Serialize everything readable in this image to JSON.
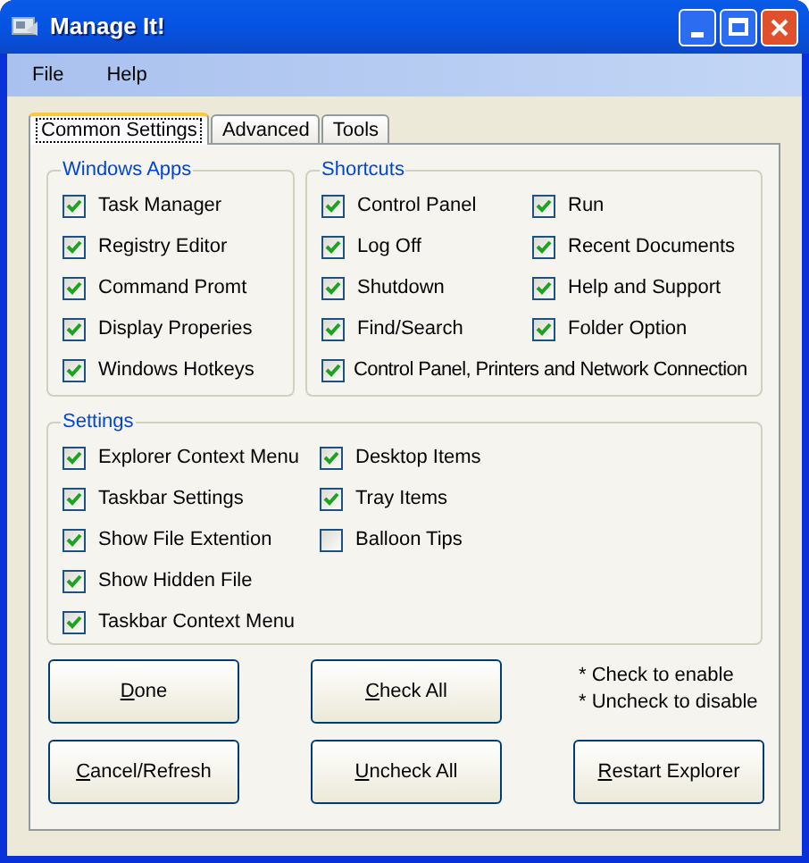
{
  "window": {
    "title": "Manage It!"
  },
  "menu": [
    "File",
    "Help"
  ],
  "tabs": [
    {
      "label": "Common Settings",
      "selected": true
    },
    {
      "label": "Advanced",
      "selected": false
    },
    {
      "label": "Tools",
      "selected": false
    }
  ],
  "windows_apps": {
    "title": "Windows Apps",
    "items": [
      {
        "label": "Task Manager",
        "checked": true
      },
      {
        "label": "Registry Editor",
        "checked": true
      },
      {
        "label": "Command Promt",
        "checked": true
      },
      {
        "label": "Display Properies",
        "checked": true
      },
      {
        "label": "Windows Hotkeys",
        "checked": true
      }
    ]
  },
  "shortcuts": {
    "title": "Shortcuts",
    "items": [
      {
        "label": "Control Panel",
        "checked": true,
        "kind": "normal"
      },
      {
        "label": "Run",
        "checked": true,
        "kind": "normal"
      },
      {
        "label": "Log Off",
        "checked": true,
        "kind": "normal"
      },
      {
        "label": "Recent Documents",
        "checked": true,
        "kind": "normal"
      },
      {
        "label": "Shutdown",
        "checked": true,
        "kind": "normal"
      },
      {
        "label": "Help and Support",
        "checked": true,
        "kind": "normal"
      },
      {
        "label": "Find/Search",
        "checked": true,
        "kind": "normal"
      },
      {
        "label": "Folder Option",
        "checked": true,
        "kind": "normal"
      },
      {
        "label": "Control Panel, Printers and Network Connection",
        "checked": true,
        "kind": "wide"
      }
    ]
  },
  "settings": {
    "title": "Settings",
    "items": [
      {
        "label": "Explorer Context Menu",
        "checked": true
      },
      {
        "label": "Taskbar Settings",
        "checked": true
      },
      {
        "label": "Show File Extention",
        "checked": true
      },
      {
        "label": "Show Hidden File",
        "checked": true
      },
      {
        "label": "Taskbar Context Menu",
        "checked": true
      },
      {
        "label": "Desktop Items",
        "checked": true
      },
      {
        "label": "Tray Items",
        "checked": true
      },
      {
        "label": "Balloon Tips",
        "checked": false
      }
    ]
  },
  "buttons": [
    {
      "label": "Done",
      "kind": "button"
    },
    {
      "label": "Check All",
      "kind": "button"
    },
    {
      "kind": "notes",
      "lines": [
        "* Check to enable",
        "* Uncheck to disable"
      ]
    },
    {
      "label": "Cancel/Refresh",
      "kind": "button"
    },
    {
      "label": "Uncheck All",
      "kind": "button"
    },
    {
      "label": "Restart Explorer",
      "kind": "button"
    }
  ]
}
